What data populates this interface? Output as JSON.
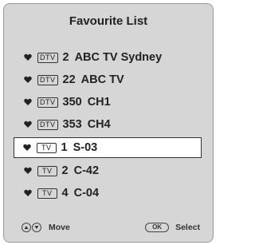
{
  "title": "Favourite List",
  "items": [
    {
      "type": "DTV",
      "number": "2",
      "name": "ABC TV Sydney",
      "selected": false
    },
    {
      "type": "DTV",
      "number": "22",
      "name": "ABC TV",
      "selected": false
    },
    {
      "type": "DTV",
      "number": "350",
      "name": "CH1",
      "selected": false
    },
    {
      "type": "DTV",
      "number": "353",
      "name": "CH4",
      "selected": false
    },
    {
      "type": "TV",
      "number": "1",
      "name": "S-03",
      "selected": true
    },
    {
      "type": "TV",
      "number": "2",
      "name": "C-42",
      "selected": false
    },
    {
      "type": "TV",
      "number": "4",
      "name": "C-04",
      "selected": false
    }
  ],
  "footer": {
    "move_label": "Move",
    "ok_label": "OK",
    "select_label": "Select"
  },
  "icons": {
    "favourite": "heart-icon",
    "up": "up-arrow-icon",
    "down": "down-arrow-icon"
  }
}
